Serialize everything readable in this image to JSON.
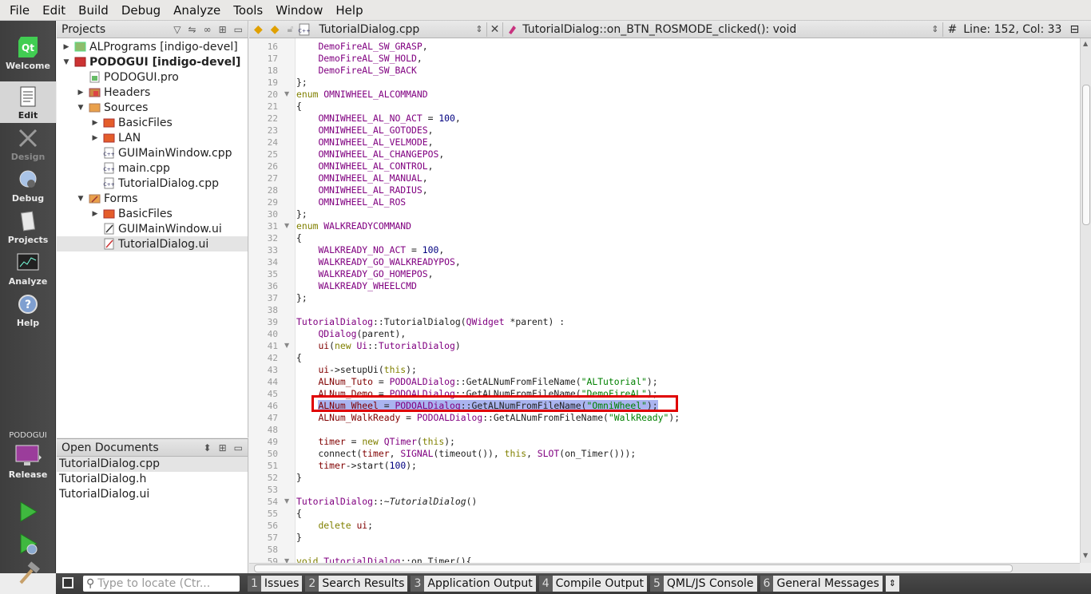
{
  "menu": [
    "File",
    "Edit",
    "Build",
    "Debug",
    "Analyze",
    "Tools",
    "Window",
    "Help"
  ],
  "modes": [
    {
      "label": "Welcome",
      "icon": "qt-logo-icon"
    },
    {
      "label": "Edit",
      "icon": "edit-document-icon"
    },
    {
      "label": "Design",
      "icon": "design-tools-icon"
    },
    {
      "label": "Debug",
      "icon": "debug-bug-icon"
    },
    {
      "label": "Projects",
      "icon": "projects-book-icon"
    },
    {
      "label": "Analyze",
      "icon": "analyze-monitor-icon"
    },
    {
      "label": "Help",
      "icon": "help-question-icon"
    }
  ],
  "kit": {
    "project": "PODOGUI",
    "config": "Release"
  },
  "projects_panel": {
    "title": "Projects",
    "tree": [
      "ALPrograms [indigo-devel]",
      "PODOGUI [indigo-devel]",
      "PODOGUI.pro",
      "Headers",
      "Sources",
      "BasicFiles",
      "LAN",
      "GUIMainWindow.cpp",
      "main.cpp",
      "TutorialDialog.cpp",
      "Forms",
      "BasicFiles",
      "GUIMainWindow.ui",
      "TutorialDialog.ui"
    ]
  },
  "open_documents": {
    "title": "Open Documents",
    "items": [
      "TutorialDialog.cpp",
      "TutorialDialog.h",
      "TutorialDialog.ui"
    ]
  },
  "editor": {
    "file": "TutorialDialog.cpp",
    "symbol": "TutorialDialog::on_BTN_ROSMODE_clicked(): void",
    "hash": "#",
    "position": "Line: 152, Col: 33",
    "line_numbers": [
      "16",
      "17",
      "18",
      "19",
      "20",
      "21",
      "22",
      "23",
      "24",
      "25",
      "26",
      "27",
      "28",
      "29",
      "30",
      "31",
      "32",
      "33",
      "34",
      "35",
      "36",
      "37",
      "38",
      "39",
      "40",
      "41",
      "42",
      "43",
      "44",
      "45",
      "46",
      "47",
      "48",
      "49",
      "50",
      "51",
      "52",
      "53",
      "54",
      "55",
      "56",
      "57",
      "58",
      "59"
    ]
  },
  "locator": {
    "placeholder": "Type to locate (Ctr..."
  },
  "output_tabs": [
    {
      "n": "1",
      "label": "Issues"
    },
    {
      "n": "2",
      "label": "Search Results"
    },
    {
      "n": "3",
      "label": "Application Output"
    },
    {
      "n": "4",
      "label": "Compile Output"
    },
    {
      "n": "5",
      "label": "QML/JS Console"
    },
    {
      "n": "6",
      "label": "General Messages"
    }
  ]
}
